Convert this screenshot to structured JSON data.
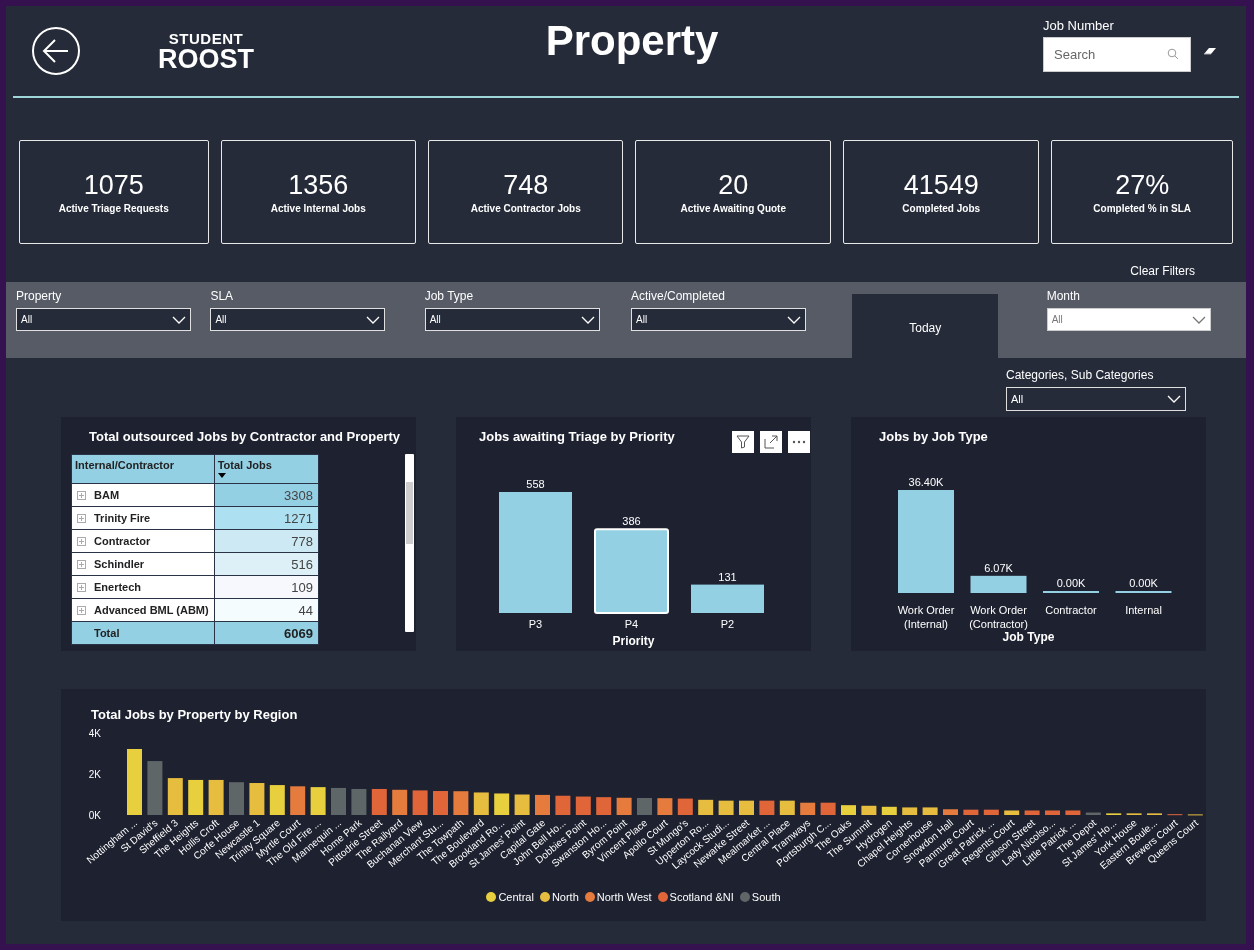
{
  "header": {
    "logo_top": "STUDENT",
    "logo_bottom": "ROOST",
    "title": "Property",
    "search_label": "Job Number",
    "search": {
      "placeholder": "Search"
    }
  },
  "kpis": [
    {
      "value": "1075",
      "label": "Active Triage Requests"
    },
    {
      "value": "1356",
      "label": "Active Internal Jobs"
    },
    {
      "value": "748",
      "label": "Active Contractor Jobs"
    },
    {
      "value": "20",
      "label": "Active Awaiting Quote"
    },
    {
      "value": "41549",
      "label": "Completed Jobs"
    },
    {
      "value": "27%",
      "label": "Completed % in SLA"
    }
  ],
  "clear_filters": "Clear Filters",
  "filters": [
    {
      "kind": "dropdown",
      "label": "Property",
      "value": "All",
      "light": false
    },
    {
      "kind": "dropdown",
      "label": "SLA",
      "value": "All",
      "light": false
    },
    {
      "kind": "dropdown",
      "label": "Job Type",
      "value": "All",
      "light": false
    },
    {
      "kind": "dropdown",
      "label": "Active/Completed",
      "value": "All",
      "light": false
    },
    {
      "kind": "button",
      "label": "Today"
    },
    {
      "kind": "dropdown",
      "label": "Month",
      "value": "All",
      "light": true
    }
  ],
  "category_filter": {
    "label": "Categories, Sub Categories",
    "value": "All"
  },
  "contractor_table": {
    "title": "Total outsourced Jobs by Contractor and Property",
    "columns": [
      "Internal/Contractor",
      "Total Jobs"
    ],
    "rows": [
      {
        "name": "BAM",
        "value": "3308",
        "color": "#94d0e4"
      },
      {
        "name": "Trinity Fire",
        "value": "1271",
        "color": "#ade0f0"
      },
      {
        "name": "Contractor",
        "value": "778",
        "color": "#cdeaf4"
      },
      {
        "name": "Schindler",
        "value": "516",
        "color": "#ddf0f7"
      },
      {
        "name": "Enertech",
        "value": "109",
        "color": "#f7f8fd"
      },
      {
        "name": "Advanced BML (ABM)",
        "value": "44",
        "color": "#f4fcfd"
      }
    ],
    "total": {
      "name": "Total",
      "value": "6069"
    }
  },
  "triage_chart": {
    "highlighted": [
      false,
      true,
      false
    ],
    "chart_data": {
      "type": "bar",
      "title": "Jobs awaiting Triage by Priority",
      "xlabel": "Priority",
      "categories": [
        "P3",
        "P4",
        "P2"
      ],
      "values": [
        558,
        386,
        131
      ],
      "data_labels": true
    }
  },
  "jobtype_chart": {
    "chart_data": {
      "type": "bar",
      "title": "Jobs by Job Type",
      "xlabel": "Job Type",
      "categories": [
        "Work Order (Internal)",
        "Work Order (Contractor)",
        "Contractor",
        "Internal"
      ],
      "values": [
        36400,
        6070,
        0,
        0
      ],
      "value_labels": [
        "36.40K",
        "6.07K",
        "0.00K",
        "0.00K"
      ]
    }
  },
  "region_chart": {
    "chart_data": {
      "type": "bar",
      "title": "Total Jobs by Property by Region",
      "stacked": true,
      "legend": "bottom",
      "yticks": [
        {
          "value": 0,
          "label": "0K"
        },
        {
          "value": 2000,
          "label": "2K"
        },
        {
          "value": 4000,
          "label": "4K"
        }
      ],
      "ylim": [
        0,
        4000
      ],
      "categories": [
        "Nottingham ...",
        "St David's",
        "Sheffield 3",
        "The Heights",
        "Hollis Croft",
        "Corfe House",
        "Newcastle 1",
        "Trinity Square",
        "Myrtle Court",
        "The Old Fire ...",
        "Mannequin ...",
        "Home Park",
        "Pittodrie Street",
        "The Railyard",
        "Buchanan View",
        "Merchant Stu...",
        "The Towpath",
        "The Boulevard",
        "Brookland Ro...",
        "St James' Point",
        "Capital Gate",
        "John Bell Ho...",
        "Dobbies Point",
        "Swanston Ho...",
        "Byrom Point",
        "Vincent Place",
        "Apollo Court",
        "St Mungo's",
        "Upperton Ro...",
        "Laycock Studi...",
        "Newarke Street",
        "Mealmarket ...",
        "Central Place",
        "Tramways",
        "Portsburgh C...",
        "The Oaks",
        "The Summit",
        "Hydrogen",
        "Chapel Heights",
        "Cornerhouse",
        "Snowdon Hall",
        "Panmure Court",
        "Great Patrick ...",
        "Regents Court",
        "Gibson Street",
        "Lady Nicolso...",
        "Little Patrick ...",
        "The Depot",
        "St James' Ho...",
        "York House",
        "Eastern Boule...",
        "Brewers Court",
        "Queens Court"
      ],
      "series": [
        {
          "name": "Central",
          "color": "#e8cf3e",
          "values": [
            3220,
            null,
            null,
            1710,
            null,
            null,
            null,
            1460,
            null,
            1360,
            null,
            null,
            null,
            null,
            null,
            null,
            null,
            null,
            1050,
            null,
            null,
            null,
            null,
            null,
            null,
            null,
            null,
            null,
            null,
            null,
            null,
            null,
            null,
            null,
            null,
            480,
            null,
            400,
            null,
            null,
            null,
            null,
            null,
            null,
            null,
            null,
            null,
            null,
            80,
            null,
            null,
            null,
            null
          ]
        },
        {
          "name": "North",
          "color": "#e6bd3f",
          "values": [
            null,
            null,
            1800,
            null,
            1710,
            null,
            1560,
            null,
            null,
            null,
            null,
            null,
            null,
            null,
            null,
            null,
            null,
            1100,
            null,
            1000,
            null,
            null,
            null,
            null,
            null,
            null,
            null,
            null,
            740,
            700,
            700,
            null,
            700,
            null,
            null,
            null,
            450,
            null,
            370,
            370,
            null,
            null,
            null,
            220,
            null,
            null,
            null,
            null,
            null,
            80,
            80,
            null,
            30
          ]
        },
        {
          "name": "North West",
          "color": "#e57c3e",
          "values": [
            null,
            null,
            null,
            null,
            null,
            null,
            null,
            null,
            1400,
            null,
            null,
            null,
            null,
            1230,
            null,
            null,
            1160,
            null,
            null,
            null,
            980,
            null,
            null,
            null,
            840,
            null,
            820,
            null,
            null,
            null,
            null,
            null,
            null,
            600,
            null,
            null,
            null,
            null,
            null,
            null,
            280,
            null,
            null,
            null,
            null,
            null,
            null,
            null,
            null,
            null,
            null,
            null,
            null
          ]
        },
        {
          "name": "Scotland &NI",
          "color": "#e0663a",
          "values": [
            null,
            null,
            null,
            null,
            null,
            null,
            null,
            null,
            null,
            null,
            null,
            null,
            1270,
            null,
            1200,
            1170,
            null,
            null,
            null,
            null,
            null,
            940,
            900,
            870,
            null,
            null,
            null,
            800,
            null,
            null,
            null,
            700,
            null,
            null,
            600,
            null,
            null,
            null,
            null,
            null,
            null,
            260,
            260,
            null,
            220,
            220,
            220,
            null,
            null,
            null,
            null,
            40,
            null
          ]
        },
        {
          "name": "South",
          "color": "#5f6668",
          "values": [
            null,
            2630,
            null,
            null,
            null,
            1600,
            null,
            null,
            null,
            null,
            1320,
            1270,
            null,
            null,
            null,
            null,
            null,
            null,
            null,
            null,
            null,
            null,
            null,
            null,
            null,
            830,
            null,
            null,
            null,
            null,
            null,
            null,
            null,
            null,
            null,
            null,
            null,
            null,
            null,
            null,
            null,
            null,
            null,
            null,
            null,
            null,
            null,
            120,
            null,
            null,
            null,
            null,
            null
          ]
        }
      ]
    }
  }
}
